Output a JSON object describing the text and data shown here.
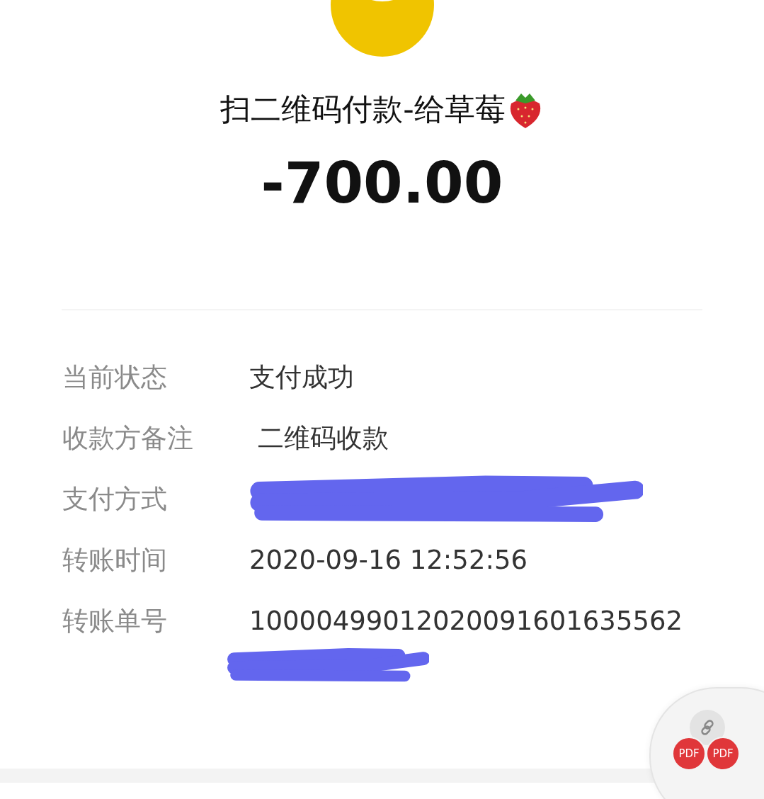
{
  "title": "扫二维码付款-给草莓",
  "amount": "-700.00",
  "details": [
    {
      "label": "当前状态",
      "value": "支付成功",
      "redacted": false
    },
    {
      "label": "收款方备注",
      "value": " 二维码收款",
      "redacted": false
    },
    {
      "label": "支付方式",
      "redacted": true
    },
    {
      "label": "转账时间",
      "value": "2020-09-16 12:52:56",
      "redacted": false
    },
    {
      "label": "转账单号",
      "value": "10000499012020091601635562",
      "redacted": true
    }
  ],
  "attachments": [
    "PDF",
    "PDF"
  ]
}
